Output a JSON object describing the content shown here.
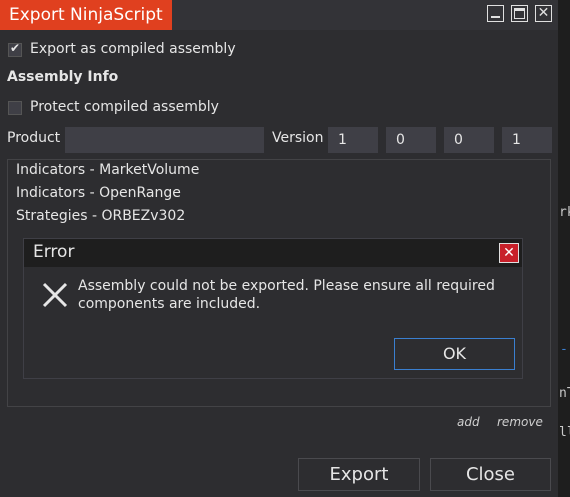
{
  "window": {
    "title": "Export NinjaScript",
    "minimize_label": "",
    "maximize_label": "",
    "close_label": "✕"
  },
  "options": {
    "export_compiled_label": "Export as compiled assembly",
    "export_compiled_checked": true,
    "assembly_info_heading": "Assembly Info",
    "protect_label": "Protect compiled assembly",
    "protect_checked": false
  },
  "product": {
    "label": "Product",
    "value": ""
  },
  "version": {
    "label": "Version",
    "parts": [
      "1",
      "0",
      "0",
      "1"
    ]
  },
  "components": [
    "Indicators - MarketVolume",
    "Indicators - OpenRange",
    "Strategies - ORBEZv302"
  ],
  "error_dialog": {
    "title": "Error",
    "message": "Assembly could not be exported. Please ensure all required components are included.",
    "ok_label": "OK"
  },
  "list_actions": {
    "add_label": "add",
    "remove_label": "remove"
  },
  "footer": {
    "export_label": "Export",
    "close_label": "Close"
  },
  "background_fragments": [
    "rk",
    "-",
    "nT",
    "ll"
  ],
  "colors": {
    "title_accent": "#e0401f",
    "background": "#2d2d30",
    "ok_border": "#3a7fd0",
    "error_close": "#c8202a"
  }
}
